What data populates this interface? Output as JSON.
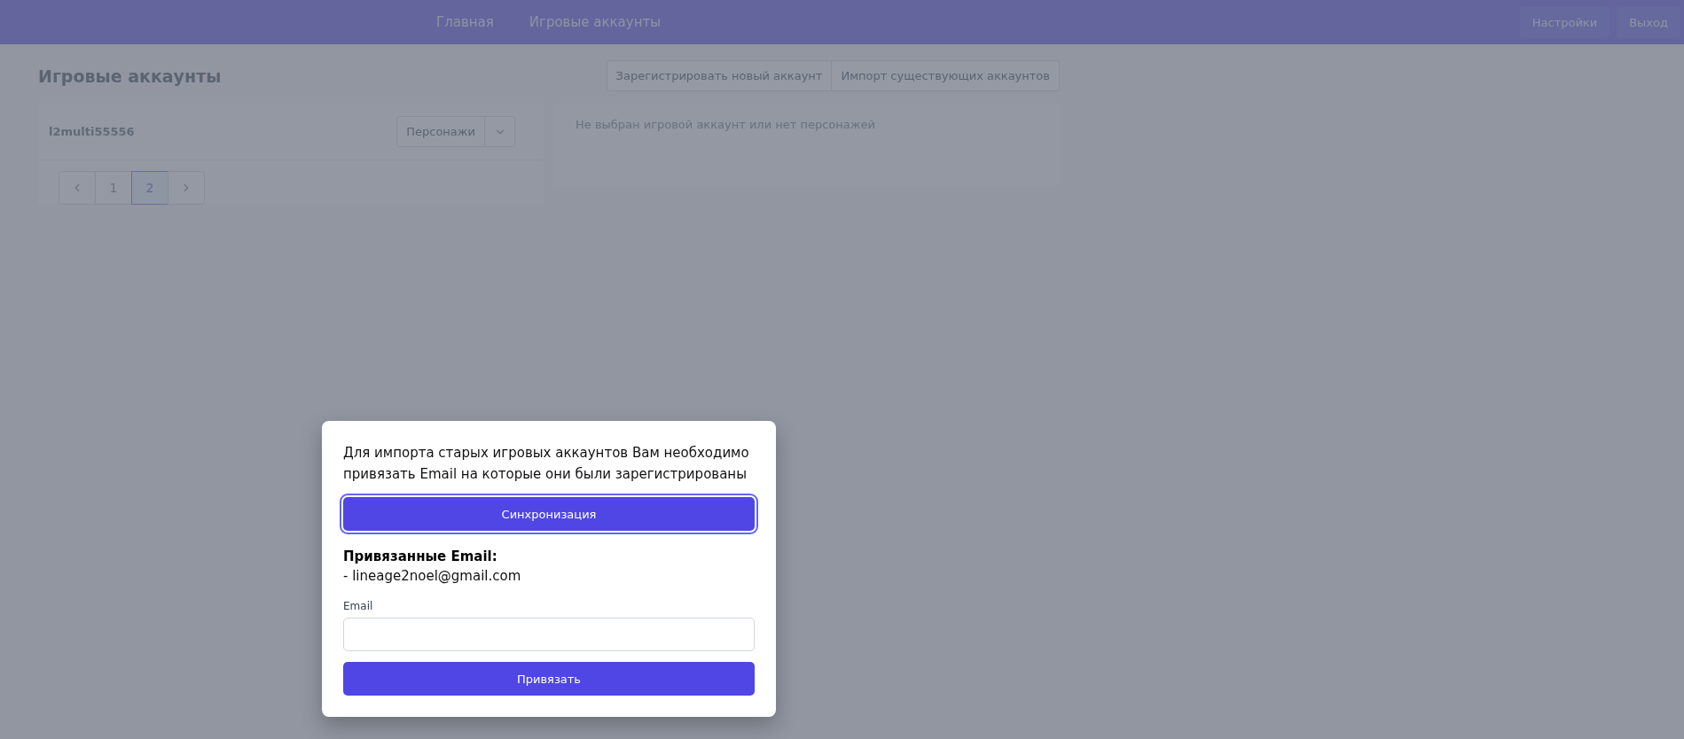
{
  "nav": {
    "links": [
      "Главная",
      "Игровые аккаунты"
    ],
    "actions": [
      "Настройки",
      "Выход"
    ]
  },
  "page": {
    "title": "Игровые аккаунты",
    "actions": [
      "Зарегистрировать новый аккаунт",
      "Импорт существующих аккаунтов"
    ]
  },
  "accounts": [
    {
      "name": "l2multi55556",
      "button": "Персонажи"
    }
  ],
  "pagination": {
    "pages": [
      {
        "label": "1",
        "selected": false
      },
      {
        "label": "2",
        "selected": true
      }
    ]
  },
  "details": {
    "empty_text": "Не выбран игровой аккаунт или нет персонажей"
  },
  "modal": {
    "message": "Для импорта старых игровых аккаунтов Вам необходимо привязать Email на которые они были зарегистрированы",
    "sync_button": "Синхронизация",
    "linked_title": "Привязанные Email:",
    "linked_emails": [
      "- lineage2noel@gmail.com"
    ],
    "field_label": "Email",
    "submit_button": "Привязать"
  }
}
